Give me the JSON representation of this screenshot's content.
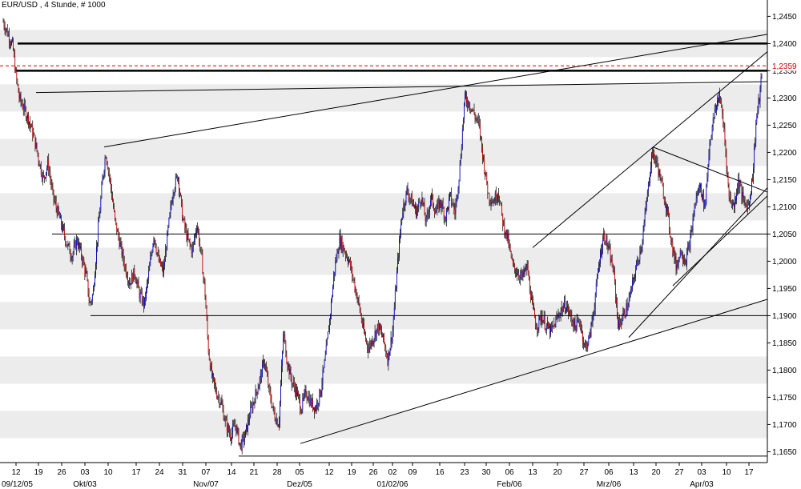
{
  "chart_data": {
    "type": "candlestick",
    "title": "EUR/USD , 4 Stunde, # 1000",
    "ylim": [
      1.163,
      1.248
    ],
    "y_ticks": [
      "1,1650",
      "1,1700",
      "1,1750",
      "1,1800",
      "1,1850",
      "1,1900",
      "1,1950",
      "1,2000",
      "1,2050",
      "1,2100",
      "1,2150",
      "1,2200",
      "1,2250",
      "1,2300",
      "1,2350",
      "1,2400",
      "1,2450"
    ],
    "y_tick_values": [
      1.165,
      1.17,
      1.175,
      1.18,
      1.185,
      1.19,
      1.195,
      1.2,
      1.205,
      1.21,
      1.215,
      1.22,
      1.225,
      1.23,
      1.235,
      1.24,
      1.245
    ],
    "current_price_label": "1,2359",
    "current_price": 1.2359,
    "x_range": [
      0,
      1000
    ],
    "x_ticks": [
      {
        "label": "12",
        "pos": 20
      },
      {
        "label": "19",
        "pos": 48
      },
      {
        "label": "26",
        "pos": 77
      },
      {
        "label": "03",
        "pos": 106
      },
      {
        "label": "10",
        "pos": 135
      },
      {
        "label": "17",
        "pos": 170
      },
      {
        "label": "24",
        "pos": 199
      },
      {
        "label": "31",
        "pos": 228
      },
      {
        "label": "07",
        "pos": 257
      },
      {
        "label": "14",
        "pos": 289
      },
      {
        "label": "21",
        "pos": 317
      },
      {
        "label": "28",
        "pos": 346
      },
      {
        "label": "05",
        "pos": 374
      },
      {
        "label": "12",
        "pos": 411
      },
      {
        "label": "19",
        "pos": 439
      },
      {
        "label": "26",
        "pos": 466
      },
      {
        "label": "02",
        "pos": 490
      },
      {
        "label": "09",
        "pos": 515
      },
      {
        "label": "16",
        "pos": 549
      },
      {
        "label": "23",
        "pos": 580
      },
      {
        "label": "30",
        "pos": 607
      },
      {
        "label": "06",
        "pos": 636
      },
      {
        "label": "13",
        "pos": 665
      },
      {
        "label": "20",
        "pos": 696
      },
      {
        "label": "27",
        "pos": 729
      },
      {
        "label": "06",
        "pos": 760
      },
      {
        "label": "13",
        "pos": 791
      },
      {
        "label": "20",
        "pos": 819
      },
      {
        "label": "27",
        "pos": 848
      },
      {
        "label": "03",
        "pos": 876
      },
      {
        "label": "10",
        "pos": 907
      },
      {
        "label": "17",
        "pos": 935
      }
    ],
    "month_labels": [
      {
        "label": "09/12/05",
        "pos": 20
      },
      {
        "label": "Okt/03",
        "pos": 106
      },
      {
        "label": "Nov/07",
        "pos": 257
      },
      {
        "label": "Dez/05",
        "pos": 374
      },
      {
        "label": "01/02/06",
        "pos": 490
      },
      {
        "label": "Feb/06",
        "pos": 636
      },
      {
        "label": "Mrz/06",
        "pos": 760
      },
      {
        "label": "Apr/03",
        "pos": 876
      }
    ],
    "horizontal_levels": [
      {
        "value": 1.24,
        "weight": "bold",
        "x0": 22,
        "x1": 958
      },
      {
        "value": 1.235,
        "weight": "bold",
        "x0": 20,
        "x1": 958
      },
      {
        "value": 1.205,
        "weight": "thin",
        "x0": 65,
        "x1": 958
      },
      {
        "value": 1.19,
        "weight": "thin",
        "x0": 113,
        "x1": 958
      },
      {
        "value": 1.1642,
        "weight": "thin",
        "x0": 298,
        "x1": 958
      }
    ],
    "trendlines": [
      {
        "x0": 130,
        "y0": 1.221,
        "x1": 958,
        "y1": 1.2417
      },
      {
        "x0": 45,
        "y0": 1.231,
        "x1": 958,
        "y1": 1.233
      },
      {
        "x0": 665,
        "y0": 1.2025,
        "x1": 958,
        "y1": 1.2385
      },
      {
        "x0": 815,
        "y0": 1.221,
        "x1": 958,
        "y1": 1.2127
      },
      {
        "x0": 785,
        "y0": 1.186,
        "x1": 958,
        "y1": 1.2135
      },
      {
        "x0": 840,
        "y0": 1.1955,
        "x1": 958,
        "y1": 1.212
      },
      {
        "x0": 375,
        "y0": 1.1665,
        "x1": 958,
        "y1": 1.193
      }
    ],
    "price_path": [
      [
        4,
        1.244
      ],
      [
        8,
        1.2425
      ],
      [
        12,
        1.241
      ],
      [
        16,
        1.2395
      ],
      [
        20,
        1.234
      ],
      [
        24,
        1.23
      ],
      [
        30,
        1.228
      ],
      [
        36,
        1.226
      ],
      [
        42,
        1.223
      ],
      [
        48,
        1.219
      ],
      [
        54,
        1.215
      ],
      [
        60,
        1.218
      ],
      [
        66,
        1.212
      ],
      [
        72,
        1.209
      ],
      [
        78,
        1.206
      ],
      [
        84,
        1.203
      ],
      [
        90,
        1.201
      ],
      [
        96,
        1.204
      ],
      [
        102,
        1.201
      ],
      [
        108,
        1.197
      ],
      [
        112,
        1.192
      ],
      [
        116,
        1.194
      ],
      [
        122,
        1.205
      ],
      [
        128,
        1.215
      ],
      [
        132,
        1.22
      ],
      [
        138,
        1.214
      ],
      [
        144,
        1.207
      ],
      [
        150,
        1.203
      ],
      [
        156,
        1.199
      ],
      [
        162,
        1.196
      ],
      [
        168,
        1.198
      ],
      [
        174,
        1.194
      ],
      [
        180,
        1.192
      ],
      [
        186,
        1.198
      ],
      [
        192,
        1.205
      ],
      [
        198,
        1.2
      ],
      [
        204,
        1.198
      ],
      [
        210,
        1.206
      ],
      [
        216,
        1.213
      ],
      [
        222,
        1.216
      ],
      [
        228,
        1.208
      ],
      [
        234,
        1.204
      ],
      [
        240,
        1.202
      ],
      [
        246,
        1.207
      ],
      [
        252,
        1.2
      ],
      [
        256,
        1.194
      ],
      [
        260,
        1.184
      ],
      [
        264,
        1.179
      ],
      [
        270,
        1.176
      ],
      [
        276,
        1.174
      ],
      [
        282,
        1.17
      ],
      [
        288,
        1.168
      ],
      [
        294,
        1.17
      ],
      [
        300,
        1.166
      ],
      [
        306,
        1.168
      ],
      [
        312,
        1.172
      ],
      [
        318,
        1.175
      ],
      [
        324,
        1.178
      ],
      [
        330,
        1.182
      ],
      [
        336,
        1.176
      ],
      [
        342,
        1.172
      ],
      [
        348,
        1.17
      ],
      [
        354,
        1.187
      ],
      [
        358,
        1.182
      ],
      [
        364,
        1.178
      ],
      [
        370,
        1.176
      ],
      [
        376,
        1.173
      ],
      [
        382,
        1.176
      ],
      [
        388,
        1.174
      ],
      [
        394,
        1.173
      ],
      [
        400,
        1.176
      ],
      [
        406,
        1.182
      ],
      [
        412,
        1.19
      ],
      [
        418,
        1.199
      ],
      [
        424,
        1.204
      ],
      [
        430,
        1.202
      ],
      [
        436,
        1.2
      ],
      [
        442,
        1.196
      ],
      [
        448,
        1.192
      ],
      [
        454,
        1.187
      ],
      [
        460,
        1.184
      ],
      [
        466,
        1.186
      ],
      [
        472,
        1.188
      ],
      [
        478,
        1.186
      ],
      [
        484,
        1.182
      ],
      [
        490,
        1.187
      ],
      [
        496,
        1.199
      ],
      [
        502,
        1.209
      ],
      [
        508,
        1.213
      ],
      [
        514,
        1.211
      ],
      [
        520,
        1.209
      ],
      [
        526,
        1.212
      ],
      [
        532,
        1.207
      ],
      [
        538,
        1.212
      ],
      [
        544,
        1.209
      ],
      [
        550,
        1.211
      ],
      [
        556,
        1.208
      ],
      [
        562,
        1.212
      ],
      [
        568,
        1.209
      ],
      [
        574,
        1.217
      ],
      [
        580,
        1.23
      ],
      [
        586,
        1.229
      ],
      [
        592,
        1.227
      ],
      [
        598,
        1.225
      ],
      [
        604,
        1.218
      ],
      [
        610,
        1.212
      ],
      [
        616,
        1.211
      ],
      [
        622,
        1.213
      ],
      [
        628,
        1.207
      ],
      [
        634,
        1.204
      ],
      [
        640,
        1.199
      ],
      [
        646,
        1.198
      ],
      [
        652,
        1.197
      ],
      [
        658,
        1.199
      ],
      [
        664,
        1.192
      ],
      [
        670,
        1.188
      ],
      [
        676,
        1.19
      ],
      [
        682,
        1.188
      ],
      [
        688,
        1.187
      ],
      [
        694,
        1.189
      ],
      [
        700,
        1.191
      ],
      [
        706,
        1.192
      ],
      [
        712,
        1.19
      ],
      [
        718,
        1.188
      ],
      [
        724,
        1.189
      ],
      [
        730,
        1.184
      ],
      [
        736,
        1.186
      ],
      [
        742,
        1.192
      ],
      [
        748,
        1.2
      ],
      [
        754,
        1.205
      ],
      [
        760,
        1.202
      ],
      [
        766,
        1.198
      ],
      [
        772,
        1.188
      ],
      [
        778,
        1.19
      ],
      [
        784,
        1.192
      ],
      [
        790,
        1.196
      ],
      [
        796,
        1.2
      ],
      [
        802,
        1.204
      ],
      [
        808,
        1.212
      ],
      [
        814,
        1.22
      ],
      [
        820,
        1.218
      ],
      [
        826,
        1.214
      ],
      [
        832,
        1.21
      ],
      [
        838,
        1.204
      ],
      [
        844,
        1.199
      ],
      [
        850,
        1.202
      ],
      [
        856,
        1.2
      ],
      [
        862,
        1.204
      ],
      [
        868,
        1.211
      ],
      [
        874,
        1.214
      ],
      [
        880,
        1.21
      ],
      [
        886,
        1.222
      ],
      [
        892,
        1.227
      ],
      [
        898,
        1.231
      ],
      [
        904,
        1.224
      ],
      [
        910,
        1.212
      ],
      [
        916,
        1.21
      ],
      [
        922,
        1.215
      ],
      [
        928,
        1.211
      ],
      [
        934,
        1.21
      ],
      [
        940,
        1.216
      ],
      [
        944,
        1.226
      ],
      [
        948,
        1.23
      ],
      [
        952,
        1.2359
      ]
    ],
    "grid": "alternating horizontal bands",
    "colors": {
      "up": "#0000cc",
      "down": "#cc0000",
      "band": "#ececec",
      "levels": "#000000",
      "current": "#cc0000"
    }
  }
}
